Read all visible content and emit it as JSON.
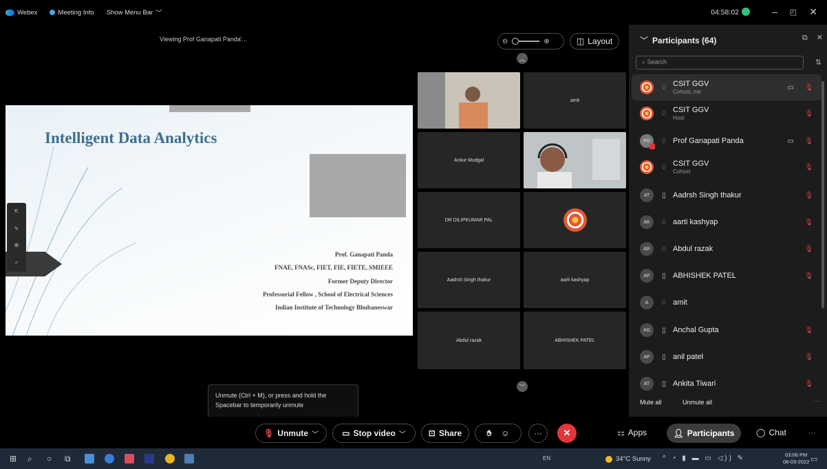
{
  "menubar": {
    "app_name": "Webex",
    "meeting_info": "Meeting Info",
    "show_menu_bar": "Show Menu Bar",
    "timer": "04:58:02"
  },
  "stage": {
    "viewing_label": "Viewing Prof Ganapati Panda'...",
    "layout_label": "Layout"
  },
  "slide": {
    "title": "Intelligent Data Analytics",
    "lines": [
      "Prof. Ganapati Panda",
      "FNAE, FNASc, FIET, FIE, FIETE, SMIEEE",
      "Former Deputy Director",
      "Professorial Fellow , School of Electrical Sciences",
      "Indian Institute of Technology Bhubaneswar"
    ]
  },
  "video_tiles": {
    "t_amit": "amit",
    "t_ankur": "Ankur Mudgal",
    "t_dilip": "DR DILIPKUMAR PAL",
    "t_aadrsh": "Aadrsh Singh thakur",
    "t_aarti": "aarti kashyap",
    "t_abdul": "Abdul razak",
    "t_abhishek": "ABHISHEK PATEL"
  },
  "tooltip": {
    "text": "Unmute (Ctrl + M), or press and hold the Spacebar to temporarily unmute"
  },
  "participants": {
    "title": "Participants (64)",
    "search_placeholder": "Search",
    "items": [
      {
        "initials": "",
        "name": "CSIT GGV",
        "role": "Cohost, me"
      },
      {
        "initials": "",
        "name": "CSIT GGV",
        "role": "Host"
      },
      {
        "initials": "PG",
        "name": "Prof Ganapati Panda",
        "role": ""
      },
      {
        "initials": "",
        "name": "CSIT GGV",
        "role": "Cohost"
      },
      {
        "initials": "AT",
        "name": "Aadrsh Singh thakur",
        "role": ""
      },
      {
        "initials": "AK",
        "name": "aarti kashyap",
        "role": ""
      },
      {
        "initials": "AR",
        "name": "Abdul razak",
        "role": ""
      },
      {
        "initials": "AP",
        "name": "ABHISHEK PATEL",
        "role": ""
      },
      {
        "initials": "A",
        "name": "amit",
        "role": ""
      },
      {
        "initials": "AG",
        "name": "Anchal Gupta",
        "role": ""
      },
      {
        "initials": "AP",
        "name": "anil patel",
        "role": ""
      },
      {
        "initials": "AT",
        "name": "Ankita Tiwari",
        "role": ""
      }
    ],
    "mute_all": "Mute all",
    "unmute_all": "Unmute all"
  },
  "controls": {
    "unmute": "Unmute",
    "stop_video": "Stop video",
    "share": "Share",
    "apps": "Apps",
    "participants": "Participants",
    "chat": "Chat"
  },
  "taskbar": {
    "lang": "EN",
    "weather": "34°C Sunny",
    "time": "03:06 PM",
    "date": "08-03-2022"
  },
  "colors": {
    "end_call": "#e0373b",
    "muted_icon": "#e04545",
    "active_dot": "#2ec27e",
    "slide_title": "#3c6f8f"
  }
}
